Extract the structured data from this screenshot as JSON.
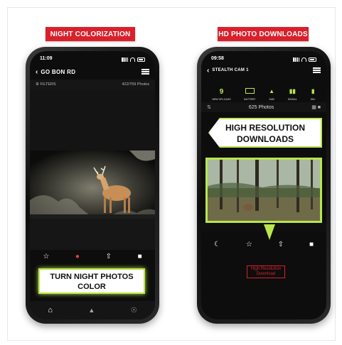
{
  "left": {
    "banner": "NIGHT COLORIZATION",
    "status_time": "11:09",
    "nav_title": "GO BON RD",
    "filters_label": "FILTERS",
    "photo_count": "422/759 Photos",
    "callout_line1": "TURN NIGHT PHOTOS",
    "callout_line2": "COLOR"
  },
  "right": {
    "banner": "HD PHOTO DOWNLOADS",
    "status_time": "09:58",
    "nav_title": "STEALTH CAM 1",
    "stats": [
      {
        "value": "9",
        "label": "NEW UPLOADS"
      },
      {
        "value": "",
        "label": "BATTERY"
      },
      {
        "value": "",
        "label": "SUB"
      },
      {
        "value": "",
        "label": "SIGNAL"
      },
      {
        "value": "",
        "label": "SDL"
      }
    ],
    "photo_count": "625 Photos",
    "callout_line1": "HIGH RESOLUTION",
    "callout_line2": "DOWNLOADS",
    "hd_button_line1": "High Resolution",
    "hd_button_line2": "Download"
  },
  "colors": {
    "banner_red": "#d9202b",
    "accent_green": "#b9e64c"
  }
}
